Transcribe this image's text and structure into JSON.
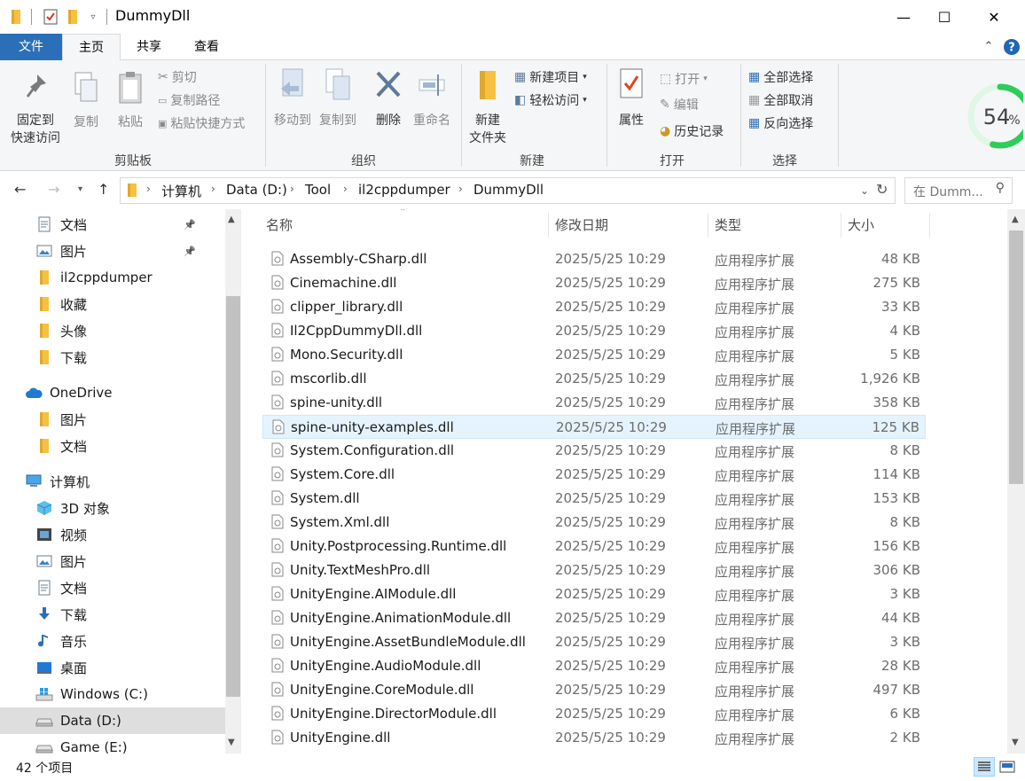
{
  "window": {
    "title": "DummyDll",
    "minimize": "—",
    "maximize": "☐",
    "close": "✕"
  },
  "tabs": {
    "file": "文件",
    "home": "主页",
    "share": "共享",
    "view": "查看"
  },
  "ribbon": {
    "clipboard": {
      "label": "剪贴板",
      "pin_line1": "固定到",
      "pin_line2": "快速访问",
      "copy": "复制",
      "paste": "粘贴",
      "cut": "剪切",
      "copy_path": "复制路径",
      "paste_shortcut": "粘贴快捷方式"
    },
    "organize": {
      "label": "组织",
      "move_to": "移动到",
      "copy_to": "复制到",
      "delete": "删除",
      "rename": "重命名"
    },
    "new": {
      "label": "新建",
      "new_folder_line1": "新建",
      "new_folder_line2": "文件夹",
      "new_item": "新建项目",
      "easy_access": "轻松访问"
    },
    "open": {
      "label": "打开",
      "properties": "属性",
      "open": "打开",
      "edit": "编辑",
      "history": "历史记录"
    },
    "select": {
      "label": "选择",
      "select_all": "全部选择",
      "select_none": "全部取消",
      "invert": "反向选择"
    }
  },
  "badge": {
    "percent": 54,
    "value": "54",
    "unit": "%"
  },
  "address": {
    "crumbs": [
      "计算机",
      "Data (D:)",
      "Tool",
      "il2cppdumper",
      "DummyDll"
    ],
    "search_placeholder": "在 Dumm..."
  },
  "nav": {
    "items": [
      {
        "label": "文档",
        "icon": "documents-icon",
        "pinned": true
      },
      {
        "label": "图片",
        "icon": "pictures-icon",
        "pinned": true
      },
      {
        "label": "il2cppdumper",
        "icon": "folder-icon"
      },
      {
        "label": "收藏",
        "icon": "folder-icon"
      },
      {
        "label": "头像",
        "icon": "folder-icon"
      },
      {
        "label": "下载",
        "icon": "folder-icon"
      },
      {
        "label": "OneDrive",
        "icon": "cloud-icon"
      },
      {
        "label": "图片",
        "icon": "folder-icon"
      },
      {
        "label": "文档",
        "icon": "folder-icon"
      },
      {
        "label": "计算机",
        "icon": "computer-icon"
      },
      {
        "label": "3D 对象",
        "icon": "3d-objects-icon"
      },
      {
        "label": "视频",
        "icon": "videos-icon"
      },
      {
        "label": "图片",
        "icon": "pictures-icon"
      },
      {
        "label": "文档",
        "icon": "documents-icon"
      },
      {
        "label": "下载",
        "icon": "downloads-icon"
      },
      {
        "label": "音乐",
        "icon": "music-icon"
      },
      {
        "label": "桌面",
        "icon": "desktop-icon"
      },
      {
        "label": "Windows (C:)",
        "icon": "windows-drive-icon"
      },
      {
        "label": "Data (D:)",
        "icon": "drive-icon",
        "selected": true
      },
      {
        "label": "Game (E:)",
        "icon": "drive-icon"
      }
    ]
  },
  "columns": {
    "name": "名称",
    "date": "修改日期",
    "type": "类型",
    "size": "大小"
  },
  "files": [
    {
      "name": "Assembly-CSharp.dll",
      "date": "2025/5/25 10:29",
      "type": "应用程序扩展",
      "size": "48 KB"
    },
    {
      "name": "Cinemachine.dll",
      "date": "2025/5/25 10:29",
      "type": "应用程序扩展",
      "size": "275 KB"
    },
    {
      "name": "clipper_library.dll",
      "date": "2025/5/25 10:29",
      "type": "应用程序扩展",
      "size": "33 KB"
    },
    {
      "name": "Il2CppDummyDll.dll",
      "date": "2025/5/25 10:29",
      "type": "应用程序扩展",
      "size": "4 KB"
    },
    {
      "name": "Mono.Security.dll",
      "date": "2025/5/25 10:29",
      "type": "应用程序扩展",
      "size": "5 KB"
    },
    {
      "name": "mscorlib.dll",
      "date": "2025/5/25 10:29",
      "type": "应用程序扩展",
      "size": "1,926 KB"
    },
    {
      "name": "spine-unity.dll",
      "date": "2025/5/25 10:29",
      "type": "应用程序扩展",
      "size": "358 KB"
    },
    {
      "name": "spine-unity-examples.dll",
      "date": "2025/5/25 10:29",
      "type": "应用程序扩展",
      "size": "125 KB",
      "highlight": true
    },
    {
      "name": "System.Configuration.dll",
      "date": "2025/5/25 10:29",
      "type": "应用程序扩展",
      "size": "8 KB"
    },
    {
      "name": "System.Core.dll",
      "date": "2025/5/25 10:29",
      "type": "应用程序扩展",
      "size": "114 KB"
    },
    {
      "name": "System.dll",
      "date": "2025/5/25 10:29",
      "type": "应用程序扩展",
      "size": "153 KB"
    },
    {
      "name": "System.Xml.dll",
      "date": "2025/5/25 10:29",
      "type": "应用程序扩展",
      "size": "8 KB"
    },
    {
      "name": "Unity.Postprocessing.Runtime.dll",
      "date": "2025/5/25 10:29",
      "type": "应用程序扩展",
      "size": "156 KB"
    },
    {
      "name": "Unity.TextMeshPro.dll",
      "date": "2025/5/25 10:29",
      "type": "应用程序扩展",
      "size": "306 KB"
    },
    {
      "name": "UnityEngine.AIModule.dll",
      "date": "2025/5/25 10:29",
      "type": "应用程序扩展",
      "size": "3 KB"
    },
    {
      "name": "UnityEngine.AnimationModule.dll",
      "date": "2025/5/25 10:29",
      "type": "应用程序扩展",
      "size": "44 KB"
    },
    {
      "name": "UnityEngine.AssetBundleModule.dll",
      "date": "2025/5/25 10:29",
      "type": "应用程序扩展",
      "size": "3 KB"
    },
    {
      "name": "UnityEngine.AudioModule.dll",
      "date": "2025/5/25 10:29",
      "type": "应用程序扩展",
      "size": "28 KB"
    },
    {
      "name": "UnityEngine.CoreModule.dll",
      "date": "2025/5/25 10:29",
      "type": "应用程序扩展",
      "size": "497 KB"
    },
    {
      "name": "UnityEngine.DirectorModule.dll",
      "date": "2025/5/25 10:29",
      "type": "应用程序扩展",
      "size": "6 KB"
    },
    {
      "name": "UnityEngine.dll",
      "date": "2025/5/25 10:29",
      "type": "应用程序扩展",
      "size": "2 KB"
    }
  ],
  "status": {
    "count": "42 个项目"
  },
  "colors": {
    "accent": "#1f66b3",
    "highlight_row": "#e5f3ff",
    "badge_ring": "#2ecc5a",
    "folder": "#f5c143"
  }
}
